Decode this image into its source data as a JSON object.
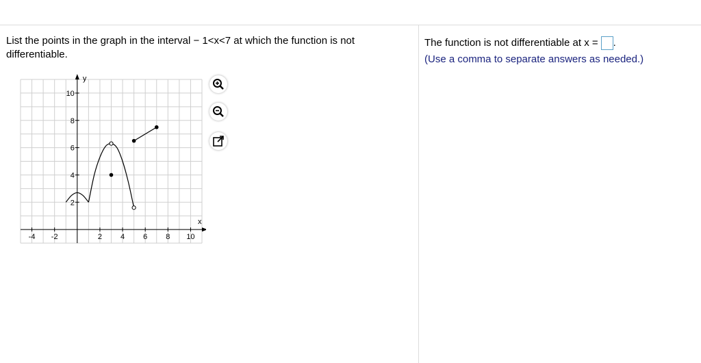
{
  "question": {
    "text": "List the points in the graph in the interval  − 1<x<7 at which the function is not differentiable."
  },
  "answer": {
    "prompt": "The function is not differentiable at x =",
    "suffix": ".",
    "value": "",
    "hint": "(Use a comma to separate answers as needed.)"
  },
  "graph": {
    "x_label": "x",
    "y_label": "y",
    "x_ticks": [
      "-4",
      "-2",
      "2",
      "4",
      "6",
      "8",
      "10"
    ],
    "y_ticks": [
      "2",
      "4",
      "6",
      "8",
      "10"
    ]
  },
  "chart_data": {
    "type": "line",
    "xlim": [
      -5,
      11
    ],
    "ylim": [
      -1,
      11
    ],
    "grid": true,
    "x_axis_label": "x",
    "y_axis_label": "y",
    "segments": [
      {
        "kind": "curve",
        "points": [
          [
            -1,
            2
          ],
          [
            -0.5,
            2.5
          ],
          [
            0,
            2.7
          ],
          [
            0.5,
            2.5
          ],
          [
            1,
            2
          ]
        ]
      },
      {
        "kind": "curve",
        "points": [
          [
            1,
            2
          ],
          [
            1.5,
            4
          ],
          [
            2,
            5.3
          ],
          [
            2.5,
            6.1
          ],
          [
            3,
            6.3
          ],
          [
            3.5,
            6
          ],
          [
            4,
            5
          ],
          [
            4.5,
            3.5
          ],
          [
            5,
            1.6
          ]
        ]
      },
      {
        "kind": "line",
        "points": [
          [
            5,
            6.5
          ],
          [
            7,
            7.5
          ]
        ]
      }
    ],
    "open_points": [
      [
        3,
        6.3
      ],
      [
        5,
        1.6
      ]
    ],
    "closed_points": [
      [
        3,
        4
      ],
      [
        5,
        6.5
      ],
      [
        7,
        7.5
      ]
    ]
  },
  "tools": {
    "zoom_in": "zoom-in-icon",
    "zoom_out": "zoom-out-icon",
    "popout": "popout-icon"
  },
  "colors": {
    "hint": "#1a237e",
    "answer_box_border": "#5aa0c8",
    "grid": "#cfcfcf"
  }
}
